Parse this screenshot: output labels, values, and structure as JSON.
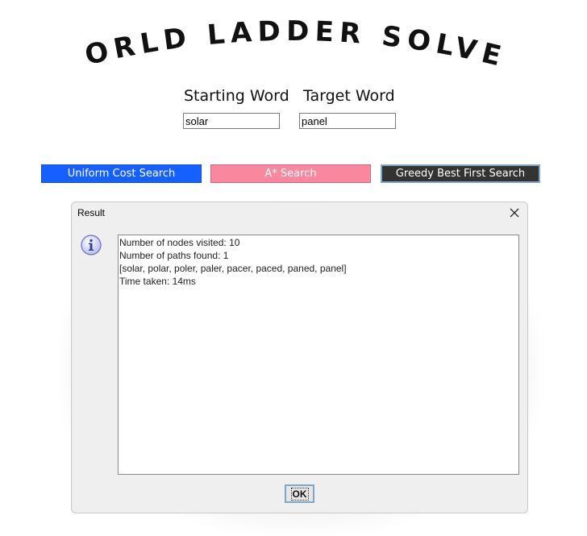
{
  "app": {
    "title": "WORLD LADDER SOLVER"
  },
  "form": {
    "start_label": "Starting Word",
    "target_label": "Target Word",
    "start_value": "solar",
    "target_value": "panel"
  },
  "buttons": {
    "ucs": "Uniform Cost Search",
    "astar": "A* Search",
    "greedy": "Greedy Best First Search"
  },
  "dialog": {
    "title": "Result",
    "lines": [
      "Number of nodes visited: 10",
      "Number of paths found: 1",
      "[solar, polar, poler, paler, pacer, paced, paned, panel]",
      "Time taken: 14ms"
    ],
    "ok_label": "OK",
    "icon": "info-icon"
  },
  "colors": {
    "ucs": "#1660ff",
    "astar": "#f9889f",
    "greedy": "#333333"
  }
}
